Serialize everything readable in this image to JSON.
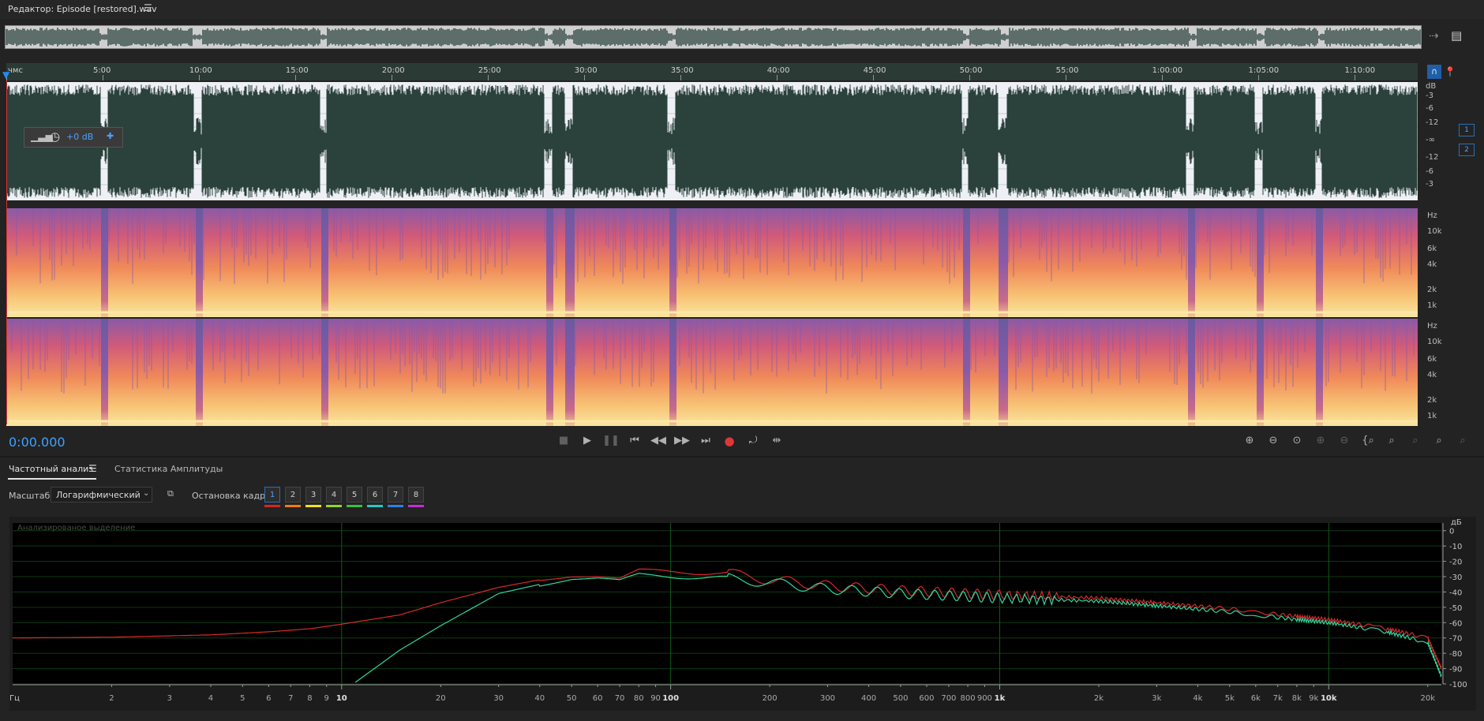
{
  "title": {
    "text": "Редактор: Episode [restored].wav",
    "menu_icon": "hamburger-icon"
  },
  "ruler": {
    "labels": [
      "чмс",
      "5:00",
      "10:00",
      "15:00",
      "20:00",
      "25:00",
      "30:00",
      "35:00",
      "40:00",
      "45:00",
      "50:00",
      "55:00",
      "1:00:00",
      "1:05:00",
      "1:10:00"
    ]
  },
  "clip_control": {
    "gain": "+0 dB"
  },
  "db_scale": [
    "dB",
    "-3",
    "-6",
    "-12",
    "-∞",
    "-12",
    "-6",
    "-3"
  ],
  "channels": [
    "1",
    "2"
  ],
  "freq_scale": [
    "Hz",
    "10k",
    "6k",
    "4k",
    "2k",
    "1k"
  ],
  "transport": {
    "timecode": "0:00.000",
    "buttons": [
      "stop-icon",
      "play-icon",
      "pause-icon",
      "skip-start-icon",
      "rewind-icon",
      "fast-forward-icon",
      "skip-end-icon",
      "record-icon",
      "loop-icon",
      "skip-selection-icon"
    ],
    "zoom_buttons": [
      "zoom-in-amplitude-icon",
      "zoom-out-amplitude-icon",
      "zoom-reset-icon",
      "zoom-in-time-icon",
      "zoom-out-time-icon",
      "zoom-selection-icon",
      "zoom-out-full-icon",
      "zoom-in-left-icon",
      "zoom-in-right-icon",
      "zoom-full-icon"
    ]
  },
  "panel": {
    "tab_freq": "Частотный анализ",
    "tab_amp": "Статистика Амплитуды",
    "scale_label": "Масштаб:",
    "scale_value": "Логарифмический",
    "freeze_label": "Остановка кадра:",
    "frames": [
      "1",
      "2",
      "3",
      "4",
      "5",
      "6",
      "7",
      "8"
    ],
    "frame_colors": [
      "#d9261c",
      "#f07a16",
      "#f2e01a",
      "#8fd62b",
      "#35c23f",
      "#22c7c9",
      "#2f7fe0",
      "#c42fd6"
    ],
    "graph_note": "Анализированое выделение"
  },
  "chart_data": {
    "type": "line",
    "xscale": "log",
    "xlabel": "Гц",
    "ylabel": "дБ",
    "x_ticks": [
      "2",
      "3",
      "4",
      "5",
      "6",
      "7",
      "8",
      "9",
      "10",
      "20",
      "30",
      "40",
      "50",
      "60",
      "70",
      "80",
      "90",
      "100",
      "200",
      "300",
      "400",
      "500",
      "600",
      "700",
      "800",
      "900",
      "1k",
      "2k",
      "3k",
      "4k",
      "5k",
      "6k",
      "7k",
      "8k",
      "9k",
      "10k",
      "20k"
    ],
    "y_ticks": [
      "0",
      "-10",
      "-20",
      "-30",
      "-40",
      "-50",
      "-60",
      "-70",
      "-80",
      "-90",
      "-100"
    ],
    "ylim": [
      -100,
      5
    ],
    "xlim": [
      1,
      22000
    ],
    "series": [
      {
        "color": "#d62a2a",
        "x": [
          1,
          2,
          4,
          6,
          8,
          10,
          15,
          20,
          30,
          40,
          50,
          60,
          70,
          80,
          100,
          150,
          200,
          300,
          500,
          800,
          1000,
          2000,
          3000,
          5000,
          8000,
          10000,
          15000,
          20000,
          22000
        ],
        "y": [
          -70,
          -69.5,
          -68,
          -66,
          -64,
          -61,
          -55,
          -47,
          -37,
          -32,
          -29,
          -29,
          -31,
          -26,
          -27,
          -28,
          -32,
          -36,
          -39,
          -41,
          -42,
          -44,
          -47,
          -51,
          -56,
          -58,
          -64,
          -70,
          -90
        ]
      },
      {
        "color": "#32d6a0",
        "x": [
          11,
          15,
          20,
          30,
          40,
          50,
          60,
          70,
          80,
          100,
          150,
          200,
          300,
          500,
          800,
          1000,
          2000,
          3000,
          5000,
          8000,
          10000,
          15000,
          20000,
          22000
        ],
        "y": [
          -99,
          -78,
          -62,
          -41,
          -35,
          -31,
          -31,
          -33,
          -29,
          -30,
          -31,
          -34,
          -38,
          -41,
          -43,
          -44,
          -46,
          -49,
          -53,
          -58,
          -60,
          -66,
          -73,
          -95
        ]
      }
    ]
  }
}
